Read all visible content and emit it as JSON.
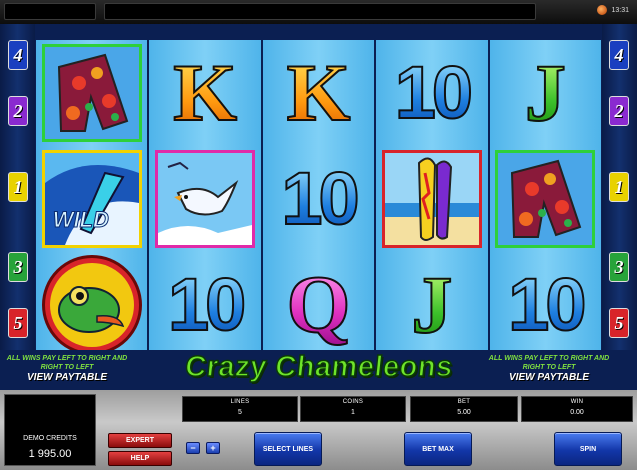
{
  "topbar": {
    "time": "13:31"
  },
  "line_indicators": {
    "left": [
      {
        "label": "4",
        "color": "#1a3fc0"
      },
      {
        "label": "2",
        "color": "#8a2ad0"
      },
      {
        "label": "1",
        "color": "#e8d200"
      },
      {
        "label": "3",
        "color": "#27a33a"
      },
      {
        "label": "5",
        "color": "#d8242a"
      }
    ],
    "right": [
      {
        "label": "4",
        "color": "#1a3fc0"
      },
      {
        "label": "2",
        "color": "#8a2ad0"
      },
      {
        "label": "1",
        "color": "#e8d200"
      },
      {
        "label": "3",
        "color": "#27a33a"
      },
      {
        "label": "5",
        "color": "#d8242a"
      }
    ]
  },
  "reels": [
    [
      "shorts-symbol",
      "wild-surfboard-symbol",
      "chameleon-symbol"
    ],
    [
      "K",
      "seagull-symbol",
      "10"
    ],
    [
      "K",
      "10",
      "Q"
    ],
    [
      "10",
      "surfboards-symbol",
      "J"
    ],
    [
      "J",
      "shorts-symbol",
      "10"
    ]
  ],
  "symbols": {
    "wild_text": "WILD"
  },
  "info": {
    "left_text": "All wins pay left to right and right to left",
    "left_link": "View Paytable",
    "right_text": "All wins pay left to right and right to left",
    "right_link": "View Paytable"
  },
  "logo": "Crazy Chameleons",
  "panel": {
    "credits_label": "DEMO CREDITS",
    "credits_value": "1 995.00",
    "lines_label": "LINES",
    "lines_value": "5",
    "coins_label": "COINS",
    "coins_value": "1",
    "bet_label": "BET",
    "bet_value": "5.00",
    "win_label": "WIN",
    "win_value": "0.00",
    "expert_label": "EXPERT",
    "help_label": "HELP",
    "minus_label": "−",
    "plus_label": "+",
    "select_lines_label": "SELECT LINES",
    "bet_max_label": "BET MAX",
    "spin_label": "SPIN"
  }
}
